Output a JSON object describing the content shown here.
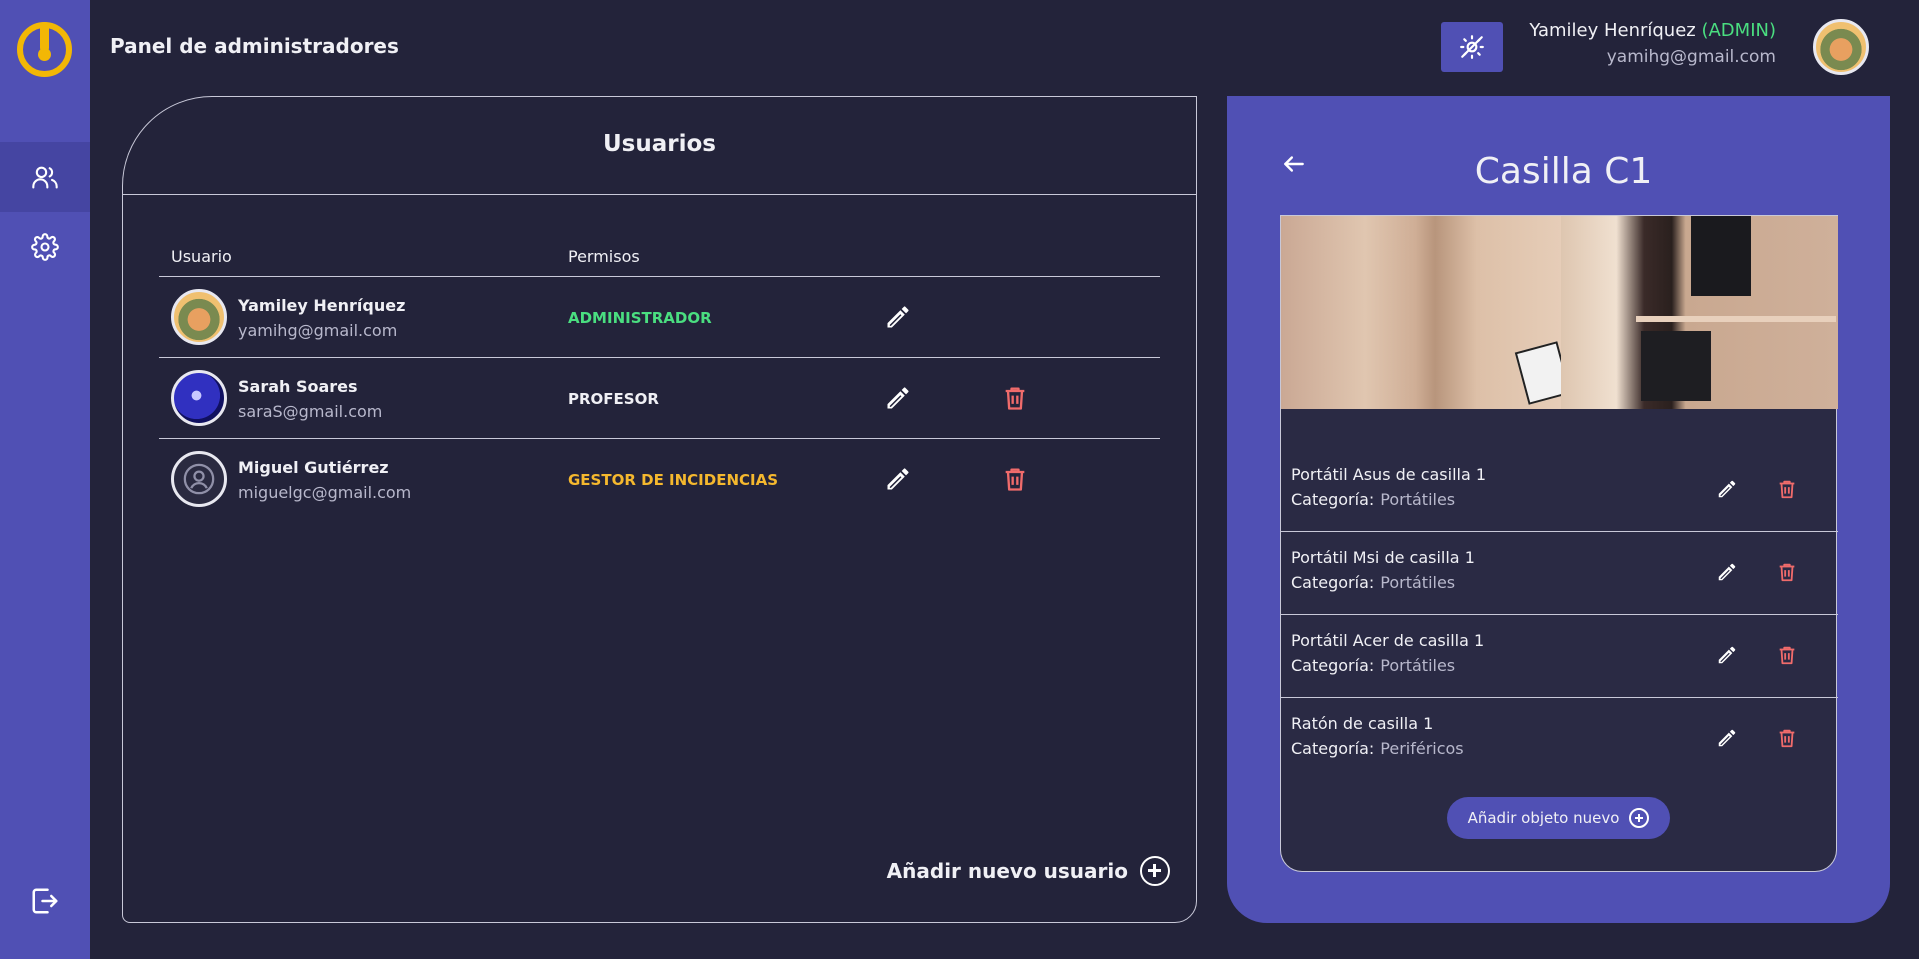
{
  "header": {
    "title": "Panel de administradores",
    "user_name": "Yamiley Henríquez",
    "user_role": "(ADMIN)",
    "user_email": "yamihg@gmail.com"
  },
  "sidebar": {
    "items": [
      {
        "name": "users",
        "icon": "users-icon"
      },
      {
        "name": "settings",
        "icon": "gear-icon"
      }
    ],
    "logout_icon": "logout-icon"
  },
  "users_panel": {
    "title": "Usuarios",
    "columns": [
      "Usuario",
      "Permisos"
    ],
    "rows": [
      {
        "name": "Yamiley Henríquez",
        "email": "yamihg@gmail.com",
        "permission": "ADMINISTRADOR",
        "permission_color": "#4ade80",
        "deletable": false
      },
      {
        "name": "Sarah Soares",
        "email": "saraS@gmail.com",
        "permission": "PROFESOR",
        "permission_color": "#f0f0f5",
        "deletable": true
      },
      {
        "name": "Miguel Gutiérrez",
        "email": "miguelgc@gmail.com",
        "permission": "GESTOR DE INCIDENCIAS",
        "permission_color": "#f5b82e",
        "deletable": true
      }
    ],
    "add_label": "Añadir nuevo usuario"
  },
  "locker_panel": {
    "title": "Casilla C1",
    "items": [
      {
        "name": "Portátil Asus de casilla 1",
        "category_label": "Categoría:",
        "category": "Portátiles"
      },
      {
        "name": "Portátil Msi de casilla 1",
        "category_label": "Categoría:",
        "category": "Portátiles"
      },
      {
        "name": "Portátil Acer de casilla 1",
        "category_label": "Categoría:",
        "category": "Portátiles"
      },
      {
        "name": "Ratón de casilla 1",
        "category_label": "Categoría:",
        "category": "Periféricos"
      }
    ],
    "add_label": "Añadir objeto nuevo"
  },
  "colors": {
    "background": "#23233a",
    "accent": "#5050b4",
    "logo": "#f2b705",
    "delete": "#f06b6b"
  }
}
